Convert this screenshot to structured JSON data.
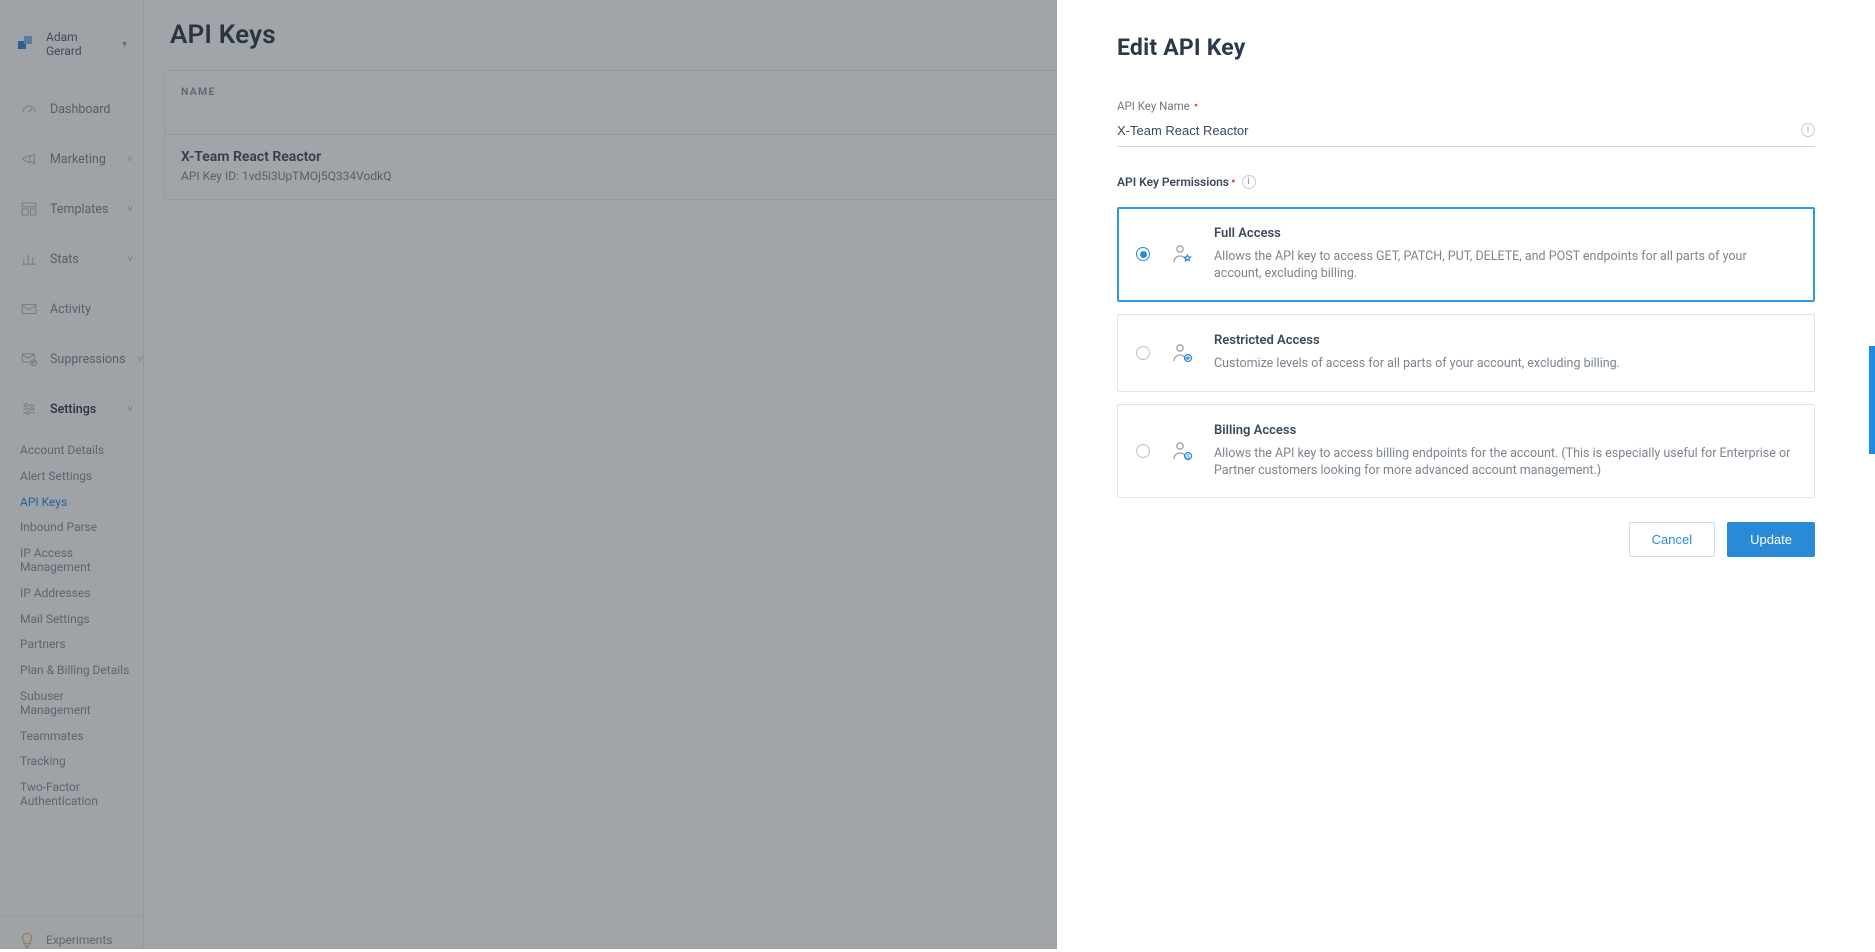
{
  "user": {
    "name": "Adam Gerard"
  },
  "nav": {
    "dashboard": "Dashboard",
    "marketing": "Marketing",
    "templates": "Templates",
    "stats": "Stats",
    "activity": "Activity",
    "suppressions": "Suppressions",
    "settings": "Settings"
  },
  "settings_sub": [
    "Account Details",
    "Alert Settings",
    "API Keys",
    "Inbound Parse",
    "IP Access Management",
    "IP Addresses",
    "Mail Settings",
    "Partners",
    "Plan & Billing Details",
    "Subuser Management",
    "Teammates",
    "Tracking",
    "Two-Factor Authentication"
  ],
  "settings_active_index": 2,
  "experiments_label": "Experiments",
  "page": {
    "title": "API Keys",
    "table_header_name": "NAME",
    "keys": [
      {
        "name": "X-Team React Reactor",
        "id_label": "API Key ID: 1vd5i3UpTMOj5Q334VodkQ"
      }
    ]
  },
  "drawer": {
    "title": "Edit API Key",
    "name_label": "API Key Name",
    "name_value": "X-Team React Reactor",
    "perms_label": "API Key Permissions",
    "options": [
      {
        "title": "Full Access",
        "desc": "Allows the API key to access GET, PATCH, PUT, DELETE, and POST endpoints for all parts of your account, excluding billing.",
        "selected": true
      },
      {
        "title": "Restricted Access",
        "desc": "Customize levels of access for all parts of your account, excluding billing.",
        "selected": false
      },
      {
        "title": "Billing Access",
        "desc": "Allows the API key to access billing endpoints for the account. (This is especially useful for Enterprise or Partner customers looking for more advanced account management.)",
        "selected": false
      }
    ],
    "cancel": "Cancel",
    "update": "Update"
  }
}
